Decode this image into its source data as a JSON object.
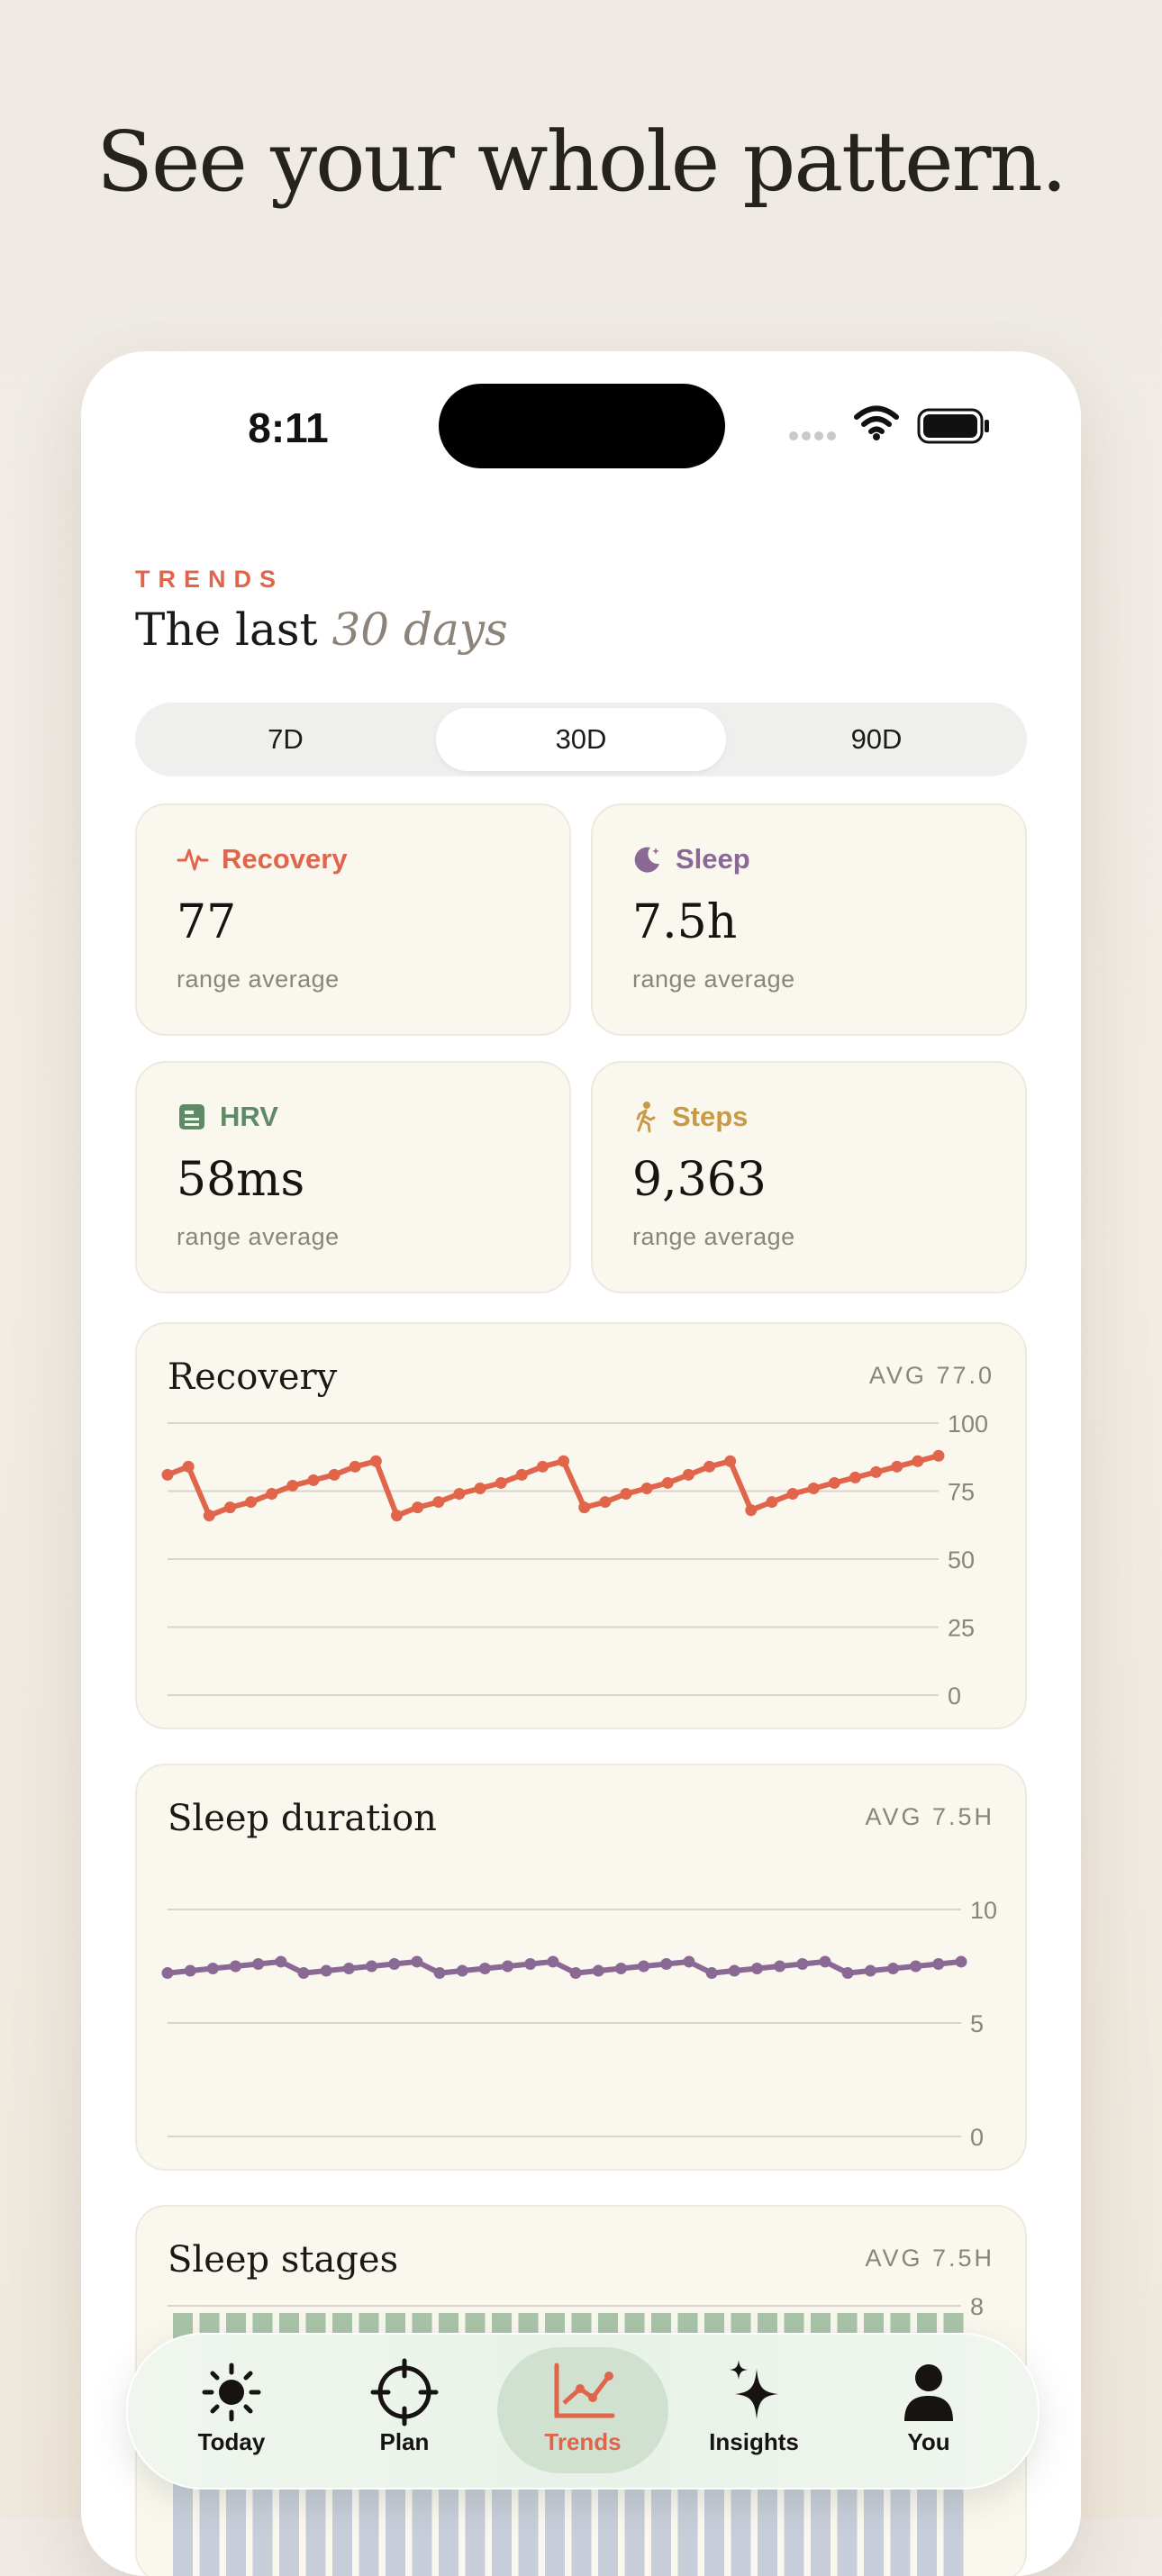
{
  "headline": "See your whole pattern.",
  "status": {
    "time": "8:11"
  },
  "page": {
    "eyebrow": "TRENDS",
    "title_prefix": "The last",
    "title_emphasis": "30 days"
  },
  "range_tabs": [
    {
      "label": "7D",
      "selected": false
    },
    {
      "label": "30D",
      "selected": true
    },
    {
      "label": "90D",
      "selected": false
    }
  ],
  "stats": [
    {
      "label": "Recovery",
      "value": "77",
      "sub": "range average",
      "color": "#e0654b",
      "icon": "pulse-icon"
    },
    {
      "label": "Sleep",
      "value": "7.5h",
      "sub": "range average",
      "color": "#8a6a94",
      "icon": "moon-icon"
    },
    {
      "label": "HRV",
      "value": "58ms",
      "sub": "range average",
      "color": "#5f8a66",
      "icon": "hrv-icon"
    },
    {
      "label": "Steps",
      "value": "9,363",
      "sub": "range average",
      "color": "#c99a45",
      "icon": "walking-icon"
    }
  ],
  "charts": {
    "recovery": {
      "title": "Recovery",
      "avg": "AVG 77.0"
    },
    "sleep_duration": {
      "title": "Sleep duration",
      "avg": "AVG 7.5H"
    },
    "sleep_stages": {
      "title": "Sleep stages",
      "avg": "AVG 7.5H"
    }
  },
  "chart_data": [
    {
      "type": "line",
      "title": "Recovery",
      "ylim": [
        0,
        100
      ],
      "yticks": [
        100,
        75,
        50,
        25,
        0
      ],
      "color": "#e0654b",
      "series": [
        {
          "values": [
            81,
            84,
            66,
            69,
            71,
            74,
            77,
            79,
            81,
            84,
            86,
            66,
            69,
            71,
            74,
            76,
            78,
            81,
            84,
            86,
            69,
            71,
            74,
            76,
            78,
            81,
            84,
            86,
            68,
            71,
            74,
            76,
            78,
            80,
            82,
            84,
            86,
            88
          ]
        }
      ]
    },
    {
      "type": "line",
      "title": "Sleep duration",
      "ylim": [
        0,
        10
      ],
      "yticks": [
        10,
        5,
        0
      ],
      "color": "#8a6a94",
      "series": [
        {
          "values": [
            7.2,
            7.3,
            7.4,
            7.5,
            7.6,
            7.7,
            7.2,
            7.3,
            7.4,
            7.5,
            7.6,
            7.7,
            7.2,
            7.3,
            7.4,
            7.5,
            7.6,
            7.7,
            7.2,
            7.3,
            7.4,
            7.5,
            7.6,
            7.7,
            7.2,
            7.3,
            7.4,
            7.5,
            7.6,
            7.7,
            7.2,
            7.3,
            7.4,
            7.5,
            7.6,
            7.7
          ]
        }
      ]
    },
    {
      "type": "bar",
      "title": "Sleep stages",
      "yticks": [
        8
      ]
    }
  ],
  "tabbar": [
    {
      "label": "Today",
      "icon": "sun-icon",
      "active": false
    },
    {
      "label": "Plan",
      "icon": "target-icon",
      "active": false
    },
    {
      "label": "Trends",
      "icon": "trends-chart-icon",
      "active": true
    },
    {
      "label": "Insights",
      "icon": "sparkles-icon",
      "active": false
    },
    {
      "label": "You",
      "icon": "person-icon",
      "active": false
    }
  ],
  "colors": {
    "accent": "#e0654b",
    "sleep": "#8a6a94",
    "hrv": "#5f8a66",
    "steps": "#c99a45",
    "card_bg": "#faf7ef"
  }
}
